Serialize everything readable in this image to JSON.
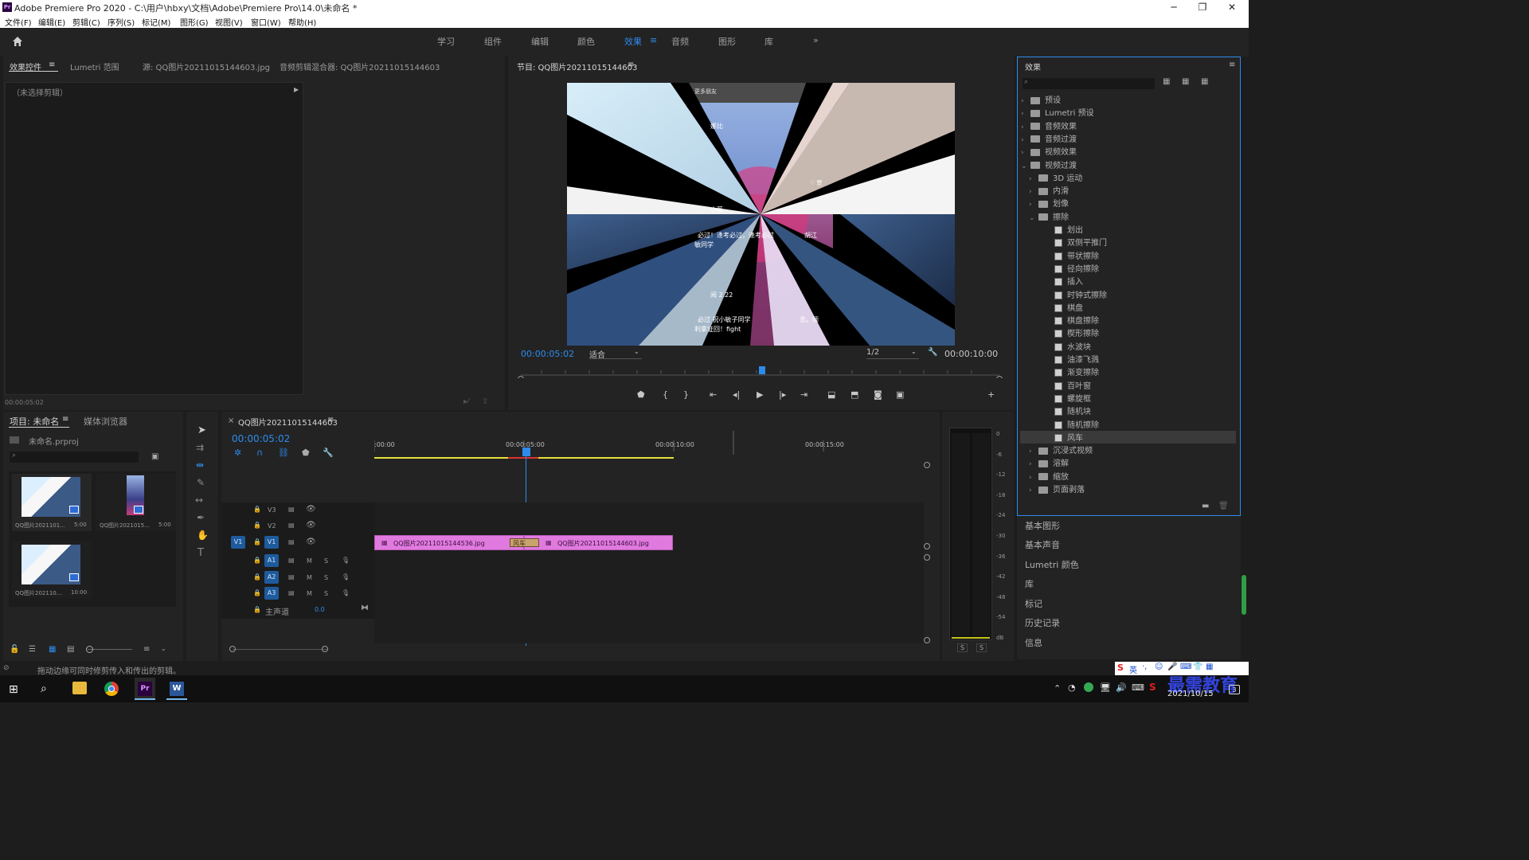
{
  "window": {
    "app_icon": "Pr",
    "title": "Adobe Premiere Pro 2020 - C:\\用户\\hbxy\\文档\\Adobe\\Premiere Pro\\14.0\\未命名 *",
    "min": "─",
    "max": "❐",
    "close": "✕"
  },
  "menu": [
    "文件(F)",
    "编辑(E)",
    "剪辑(C)",
    "序列(S)",
    "标记(M)",
    "图形(G)",
    "视图(V)",
    "窗口(W)",
    "帮助(H)"
  ],
  "workspaces": [
    "学习",
    "组件",
    "编辑",
    "颜色",
    "效果",
    "音频",
    "图形",
    "库"
  ],
  "workspace_active": "效果",
  "workspace_more": "»",
  "source_panel": {
    "tabs": [
      "效果控件",
      "Lumetri 范围",
      "源: QQ图片20211015144603.jpg",
      "音频剪辑混合器: QQ图片20211015144603"
    ],
    "no_clip": "（未选择剪辑）",
    "timecode": "00:00:05:02"
  },
  "program": {
    "title": "节目: QQ图片20211015144603",
    "timecode": "00:00:05:02",
    "fit": "适合",
    "resolution": "1/2",
    "duration": "00:00:10:00",
    "overlay_texts": [
      "更多朋友",
      "娜比",
      "♡ 赞",
      "小薇",
      "必过！逢考必过，逢考必过",
      "胡江",
      "敏同学",
      "阅 2.22",
      "必过 祝小敏子同学",
      "去。顺",
      "利拿证回！fight"
    ]
  },
  "project": {
    "tabs": [
      "项目: 未命名",
      "媒体浏览器"
    ],
    "file": "未命名.prproj",
    "items": [
      {
        "name": "QQ图片2021101...",
        "dur": "5:00"
      },
      {
        "name": "QQ图片2021015...",
        "dur": "5:00"
      },
      {
        "name": "QQ图片202110...",
        "dur": "10:00"
      }
    ]
  },
  "timeline": {
    "tab": "QQ图片20211015144603",
    "timecode": "00:00:05:02",
    "ruler": [
      ":00:00",
      "00:00:05:00",
      "00:00:10:00",
      "00:00:15:00"
    ],
    "tracks_v": [
      "V3",
      "V2",
      "V1"
    ],
    "tracks_a": [
      "A1",
      "A2",
      "A3"
    ],
    "master": "主声道",
    "master_val": "0.0",
    "src_v": "V1",
    "m": "M",
    "s": "S",
    "clips": [
      {
        "label": "QQ图片20211015144536.jpg"
      },
      {
        "label": "QQ图片20211015144603.jpg"
      }
    ],
    "transition": "风车"
  },
  "meter": {
    "scale": [
      "0",
      "-6",
      "-12",
      "-18",
      "-24",
      "-30",
      "-36",
      "-42",
      "-48",
      "-54",
      "dB"
    ],
    "solo": [
      "S",
      "S"
    ]
  },
  "effects": {
    "title": "效果",
    "tree": [
      {
        "label": "预设",
        "type": "folder",
        "level": 0,
        "open": false
      },
      {
        "label": "Lumetri 预设",
        "type": "folder",
        "level": 0,
        "open": false
      },
      {
        "label": "音频效果",
        "type": "folder",
        "level": 0,
        "open": false
      },
      {
        "label": "音频过渡",
        "type": "folder",
        "level": 0,
        "open": false
      },
      {
        "label": "视频效果",
        "type": "folder",
        "level": 0,
        "open": false
      },
      {
        "label": "视频过渡",
        "type": "folder",
        "level": 0,
        "open": true
      },
      {
        "label": "3D 运动",
        "type": "folder",
        "level": 1,
        "open": false
      },
      {
        "label": "内滑",
        "type": "folder",
        "level": 1,
        "open": false
      },
      {
        "label": "划像",
        "type": "folder",
        "level": 1,
        "open": false
      },
      {
        "label": "擦除",
        "type": "folder",
        "level": 1,
        "open": true
      },
      {
        "label": "划出",
        "type": "fx",
        "level": 2
      },
      {
        "label": "双侧平推门",
        "type": "fx",
        "level": 2
      },
      {
        "label": "带状擦除",
        "type": "fx",
        "level": 2
      },
      {
        "label": "径向擦除",
        "type": "fx",
        "level": 2
      },
      {
        "label": "插入",
        "type": "fx",
        "level": 2
      },
      {
        "label": "时钟式擦除",
        "type": "fx",
        "level": 2
      },
      {
        "label": "棋盘",
        "type": "fx",
        "level": 2
      },
      {
        "label": "棋盘擦除",
        "type": "fx",
        "level": 2
      },
      {
        "label": "楔形擦除",
        "type": "fx",
        "level": 2
      },
      {
        "label": "水波块",
        "type": "fx",
        "level": 2
      },
      {
        "label": "油漆飞溅",
        "type": "fx",
        "level": 2
      },
      {
        "label": "渐变擦除",
        "type": "fx",
        "level": 2
      },
      {
        "label": "百叶窗",
        "type": "fx",
        "level": 2
      },
      {
        "label": "螺旋框",
        "type": "fx",
        "level": 2
      },
      {
        "label": "随机块",
        "type": "fx",
        "level": 2
      },
      {
        "label": "随机擦除",
        "type": "fx",
        "level": 2
      },
      {
        "label": "风车",
        "type": "fx",
        "level": 2,
        "selected": true
      },
      {
        "label": "沉浸式视频",
        "type": "folder",
        "level": 1,
        "open": false
      },
      {
        "label": "溶解",
        "type": "folder",
        "level": 1,
        "open": false
      },
      {
        "label": "缩放",
        "type": "folder",
        "level": 1,
        "open": false
      },
      {
        "label": "页面剥落",
        "type": "folder",
        "level": 1,
        "open": false
      }
    ],
    "side_panels": [
      "基本图形",
      "基本声音",
      "Lumetri 颜色",
      "库",
      "标记",
      "历史记录",
      "信息"
    ]
  },
  "status": "拖动边缘可同时修剪传入和传出的剪辑。",
  "tray": {
    "ime": "英",
    "time": "",
    "date": "2021/10/15",
    "watermark": "最需教育"
  },
  "colors": {
    "accent": "#2d8ceb",
    "clip": "#e07adf",
    "transition": "#c9a36e",
    "selection": "#3a3a3a"
  }
}
